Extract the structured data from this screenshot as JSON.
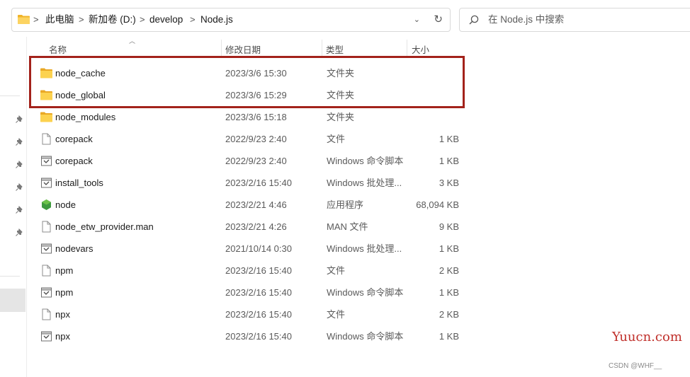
{
  "address_bar": {
    "crumbs": [
      "此电脑",
      "新加卷 (D:)",
      "develop",
      "Node.js"
    ],
    "separator": ">",
    "dropdown_glyph": "⌄",
    "refresh_glyph": "↻"
  },
  "search": {
    "placeholder": "在 Node.js 中搜索"
  },
  "columns": {
    "name": "名称",
    "date": "修改日期",
    "type": "类型",
    "size": "大小"
  },
  "files": [
    {
      "name": "node_cache",
      "date": "2023/3/6 15:30",
      "type": "文件夹",
      "size": "",
      "icon": "folder-icon"
    },
    {
      "name": "node_global",
      "date": "2023/3/6 15:29",
      "type": "文件夹",
      "size": "",
      "icon": "folder-icon"
    },
    {
      "name": "node_modules",
      "date": "2023/3/6 15:18",
      "type": "文件夹",
      "size": "",
      "icon": "folder-icon"
    },
    {
      "name": "corepack",
      "date": "2022/9/23 2:40",
      "type": "文件",
      "size": "1 KB",
      "icon": "file-icon"
    },
    {
      "name": "corepack",
      "date": "2022/9/23 2:40",
      "type": "Windows 命令脚本",
      "size": "1 KB",
      "icon": "script-icon"
    },
    {
      "name": "install_tools",
      "date": "2023/2/16 15:40",
      "type": "Windows 批处理...",
      "size": "3 KB",
      "icon": "script-icon"
    },
    {
      "name": "node",
      "date": "2023/2/21 4:46",
      "type": "应用程序",
      "size": "68,094 KB",
      "icon": "node-app-icon"
    },
    {
      "name": "node_etw_provider.man",
      "date": "2023/2/21 4:26",
      "type": "MAN 文件",
      "size": "9 KB",
      "icon": "file-icon"
    },
    {
      "name": "nodevars",
      "date": "2021/10/14 0:30",
      "type": "Windows 批处理...",
      "size": "1 KB",
      "icon": "script-icon"
    },
    {
      "name": "npm",
      "date": "2023/2/16 15:40",
      "type": "文件",
      "size": "2 KB",
      "icon": "file-icon"
    },
    {
      "name": "npm",
      "date": "2023/2/16 15:40",
      "type": "Windows 命令脚本",
      "size": "1 KB",
      "icon": "script-icon"
    },
    {
      "name": "npx",
      "date": "2023/2/16 15:40",
      "type": "文件",
      "size": "2 KB",
      "icon": "file-icon"
    },
    {
      "name": "npx",
      "date": "2023/2/16 15:40",
      "type": "Windows 命令脚本",
      "size": "1 KB",
      "icon": "script-icon"
    }
  ],
  "highlight_color": "#a3221b",
  "watermark": {
    "main": "Yuucn.com",
    "small": "CSDN @WHF__"
  }
}
